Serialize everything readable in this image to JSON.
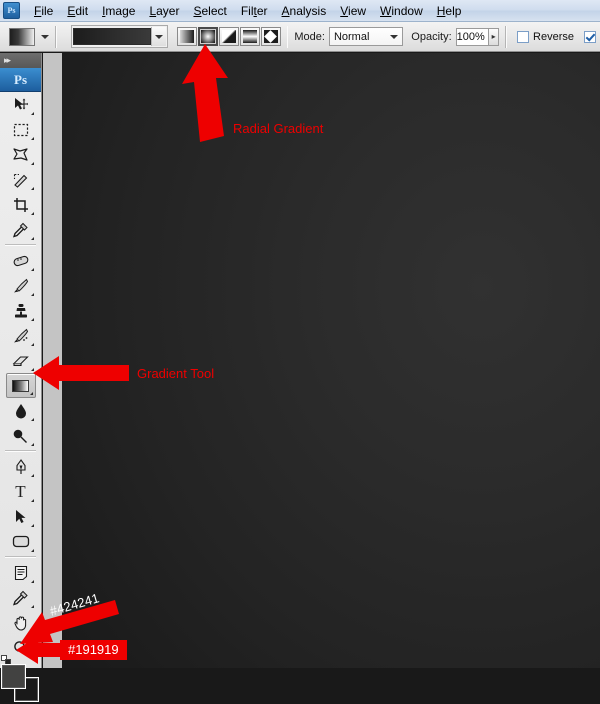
{
  "app": {
    "name": "Adobe Photoshop",
    "logo_text": "Ps"
  },
  "menubar": {
    "items": [
      {
        "label": "File",
        "mnemonic": "F"
      },
      {
        "label": "Edit",
        "mnemonic": "E"
      },
      {
        "label": "Image",
        "mnemonic": "I"
      },
      {
        "label": "Layer",
        "mnemonic": "L"
      },
      {
        "label": "Select",
        "mnemonic": "S"
      },
      {
        "label": "Filter",
        "mnemonic": "t"
      },
      {
        "label": "Analysis",
        "mnemonic": "A"
      },
      {
        "label": "View",
        "mnemonic": "V"
      },
      {
        "label": "Window",
        "mnemonic": "W"
      },
      {
        "label": "Help",
        "mnemonic": "H"
      }
    ]
  },
  "options_bar": {
    "tool_preset_name": "gradient-tool-preset",
    "gradient_picker_label": "Gradient preset",
    "gradient_types": [
      {
        "name": "Linear Gradient",
        "selected": false
      },
      {
        "name": "Radial Gradient",
        "selected": true
      },
      {
        "name": "Angle Gradient",
        "selected": false
      },
      {
        "name": "Reflected Gradient",
        "selected": false
      },
      {
        "name": "Diamond Gradient",
        "selected": false
      }
    ],
    "mode_label": "Mode:",
    "mode_value": "Normal",
    "opacity_label": "Opacity:",
    "opacity_value": "100%",
    "reverse_label": "Reverse",
    "reverse_checked": false,
    "dither_checked": true
  },
  "tools": [
    {
      "name": "move-tool",
      "glyph": "↖",
      "has_more": true,
      "selected": false
    },
    {
      "name": "rectangular-marquee",
      "glyph": "⬚",
      "has_more": true,
      "selected": false
    },
    {
      "name": "lasso-tool",
      "glyph": "✠",
      "has_more": true,
      "selected": false
    },
    {
      "name": "quick-selection-tool",
      "glyph": "✎",
      "has_more": true,
      "selected": false
    },
    {
      "name": "crop-tool",
      "glyph": "⛏",
      "has_more": true,
      "selected": false
    },
    {
      "name": "eyedropper-tool",
      "glyph": "✒",
      "has_more": true,
      "selected": false
    },
    {
      "name": "healing-brush-tool",
      "glyph": "✍",
      "has_more": true,
      "selected": false
    },
    {
      "name": "brush-tool",
      "glyph": "✐",
      "has_more": true,
      "selected": false
    },
    {
      "name": "clone-stamp-tool",
      "glyph": "⚑",
      "has_more": true,
      "selected": false
    },
    {
      "name": "history-brush-tool",
      "glyph": "⚘",
      "has_more": true,
      "selected": false
    },
    {
      "name": "eraser-tool",
      "glyph": "▱",
      "has_more": true,
      "selected": false
    },
    {
      "name": "gradient-tool",
      "glyph": "",
      "has_more": true,
      "selected": true
    },
    {
      "name": "blur-tool",
      "glyph": "●",
      "has_more": true,
      "selected": false
    },
    {
      "name": "dodge-tool",
      "glyph": "⚲",
      "has_more": true,
      "selected": false
    },
    {
      "name": "pen-tool",
      "glyph": "✒",
      "has_more": true,
      "selected": false
    },
    {
      "name": "horizontal-type-tool",
      "glyph": "T",
      "has_more": true,
      "selected": false
    },
    {
      "name": "path-selection-tool",
      "glyph": "➤",
      "has_more": true,
      "selected": false
    },
    {
      "name": "rounded-rectangle-tool",
      "glyph": "▭",
      "has_more": true,
      "selected": false
    },
    {
      "name": "notes-tool",
      "glyph": "☰",
      "has_more": true,
      "selected": false
    },
    {
      "name": "eyedropper-2-tool",
      "glyph": "⚗",
      "has_more": true,
      "selected": false
    },
    {
      "name": "hand-tool",
      "glyph": "✋",
      "has_more": false,
      "selected": false
    },
    {
      "name": "zoom-tool",
      "glyph": "⌕",
      "has_more": false,
      "selected": false
    }
  ],
  "color_swatches": {
    "foreground_color": "#424241",
    "background_color": "#191919",
    "foreground_name": "foreground-color-swatch",
    "background_name": "background-color-swatch"
  },
  "canvas": {
    "gradient_center_color": "#313131",
    "gradient_edge_color": "#161616"
  },
  "annotations": [
    {
      "id": "radial",
      "text": "Radial Gradient",
      "style": "plain",
      "color": "#ee0000"
    },
    {
      "id": "gradient",
      "text": "Gradient Tool",
      "style": "plain",
      "color": "#ee0000"
    },
    {
      "id": "fg_color",
      "text": "#424241",
      "style": "tag",
      "color": "#ffffff"
    },
    {
      "id": "bg_color",
      "text": "#191919",
      "style": "tag",
      "color": "#ffffff"
    }
  ]
}
